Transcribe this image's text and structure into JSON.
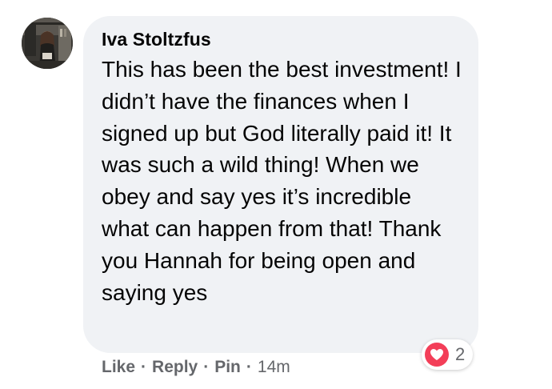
{
  "comment": {
    "author": "Iva Stoltzfus",
    "text": "This has been the best investment! I didn’t have the finances when I signed up but God literally paid it! It was such a wild thing! When we obey and say yes it’s incredible what can happen from that! Thank you Hannah for being open and saying yes",
    "actions": {
      "like_label": "Like",
      "reply_label": "Reply",
      "pin_label": "Pin",
      "separator": "·",
      "timestamp": "14m"
    },
    "reactions": {
      "icon": "heart-icon",
      "count": "2",
      "color": "#f33e58"
    }
  },
  "colors": {
    "bubble_background": "#f0f2f5",
    "text": "#050505",
    "secondary_text": "#65676b"
  }
}
